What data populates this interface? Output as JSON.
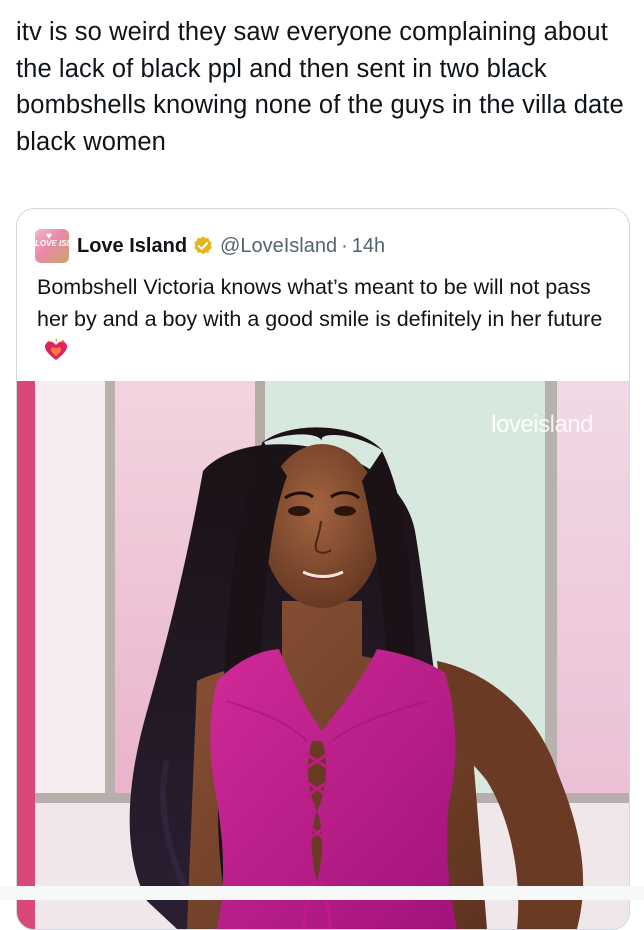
{
  "tweet": {
    "text": "itv is so weird they saw everyone complaining about the lack of black ppl and then sent in two black bombshells knowing none of the guys in the villa date black women"
  },
  "quoted_tweet": {
    "avatar_text": "LOVE ISLAND",
    "display_name": "Love Island",
    "verified_badge_color": "#e2b719",
    "handle": "@LoveIsland",
    "separator": "·",
    "timestamp": "14h",
    "text": "Bombshell Victoria knows what’s meant to be will not pass her by and a boy with a good smile is definitely in her future",
    "emoji": "heart-on-fire-emoji"
  },
  "media": {
    "watermark_love": "love",
    "watermark_island": "island",
    "subject": "woman-in-magenta-top-photo"
  },
  "colors": {
    "text_primary": "#0f1419",
    "text_secondary": "#536471",
    "border": "#cfd9de",
    "top_magenta": "#c2188a"
  }
}
